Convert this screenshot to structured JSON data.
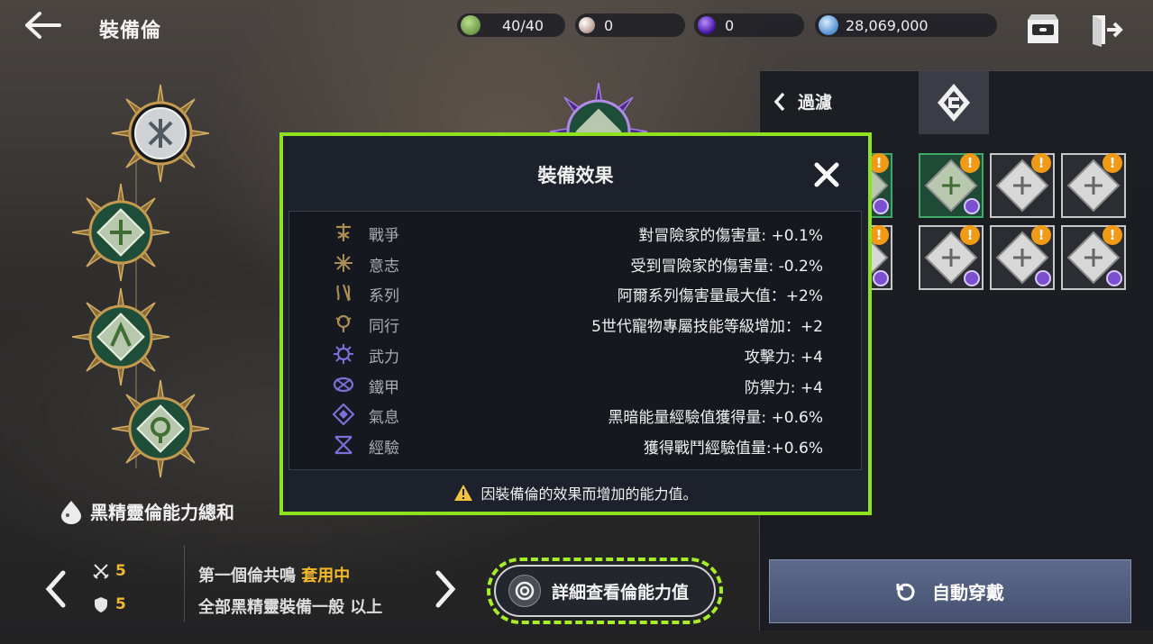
{
  "header": {
    "title": "裝備倫",
    "resources": [
      {
        "name": "stamina",
        "value": "40/40",
        "icon": "green-token-icon",
        "color": "#7fb55a"
      },
      {
        "name": "pearl",
        "value": "0",
        "icon": "pearl-icon",
        "color": "#d9b9b0"
      },
      {
        "name": "dark-orb",
        "value": "0",
        "icon": "purple-orb-icon",
        "color": "#6a2fd0"
      },
      {
        "name": "silver",
        "value": "28,069,000",
        "icon": "silver-coin-icon",
        "color": "#6fa9e0"
      }
    ],
    "icons": [
      "back-arrow-icon",
      "inbox-icon",
      "exit-door-icon"
    ]
  },
  "left": {
    "summary_label": "黑精靈倫能力總和",
    "stats": [
      {
        "icon": "crossed-swords-icon",
        "value": "5"
      },
      {
        "icon": "shield-icon",
        "value": "5"
      }
    ],
    "set_line1_prefix": "第一個倫共鳴",
    "set_line1_status": "套用中",
    "set_line2": "全部黑精靈裝備一般",
    "set_line2_suffix": "以上",
    "detail_button": "詳細查看倫能力值"
  },
  "right_panel": {
    "filter_label": "過濾",
    "sort_tab_icon": "sort-tab-icon",
    "auto_equip_label": "自動穿戴",
    "items": [
      {
        "row": 0,
        "col": 0,
        "new": true,
        "set": true,
        "selected": true,
        "partial": true
      },
      {
        "row": 0,
        "col": 1,
        "new": true,
        "set": true,
        "selected": true
      },
      {
        "row": 0,
        "col": 2,
        "new": true,
        "set": false,
        "selected": false
      },
      {
        "row": 0,
        "col": 3,
        "new": true,
        "set": false,
        "selected": false
      },
      {
        "row": 1,
        "col": 0,
        "new": true,
        "set": true,
        "selected": false,
        "partial": true
      },
      {
        "row": 1,
        "col": 1,
        "new": true,
        "set": true,
        "selected": false
      },
      {
        "row": 1,
        "col": 2,
        "new": true,
        "set": true,
        "selected": false
      },
      {
        "row": 1,
        "col": 3,
        "new": true,
        "set": true,
        "selected": false
      }
    ],
    "badge_text": "!"
  },
  "modal": {
    "title": "裝備效果",
    "close_icon": "close-icon",
    "effects": [
      {
        "name": "戰爭",
        "value": "對冒險家的傷害量: +0.1%",
        "icon": "war-rune-icon"
      },
      {
        "name": "意志",
        "value": "受到冒險家的傷害量: -0.2%",
        "icon": "will-rune-icon"
      },
      {
        "name": "系列",
        "value": "阿爾系列傷害量最大值：+2%",
        "icon": "series-rune-icon"
      },
      {
        "name": "同行",
        "value": "5世代寵物專屬技能等級增加：+2",
        "icon": "companion-rune-icon"
      },
      {
        "name": "武力",
        "value": "攻擊力: +4",
        "icon": "force-rune-icon"
      },
      {
        "name": "鐵甲",
        "value": "防禦力: +4",
        "icon": "armor-rune-icon"
      },
      {
        "name": "氣息",
        "value": "黑暗能量經驗值獲得量: +0.6%",
        "icon": "breath-rune-icon"
      },
      {
        "name": "經驗",
        "value": "獲得戰鬥經驗值量:+0.6%",
        "icon": "exp-rune-icon"
      }
    ],
    "note": "因裝備倫的效果而增加的能力值。",
    "note_icon": "warning-icon"
  },
  "colors": {
    "highlight_border": "#8ee31d",
    "accent_orange": "#f19a16",
    "set_active": "#f4b92a"
  }
}
